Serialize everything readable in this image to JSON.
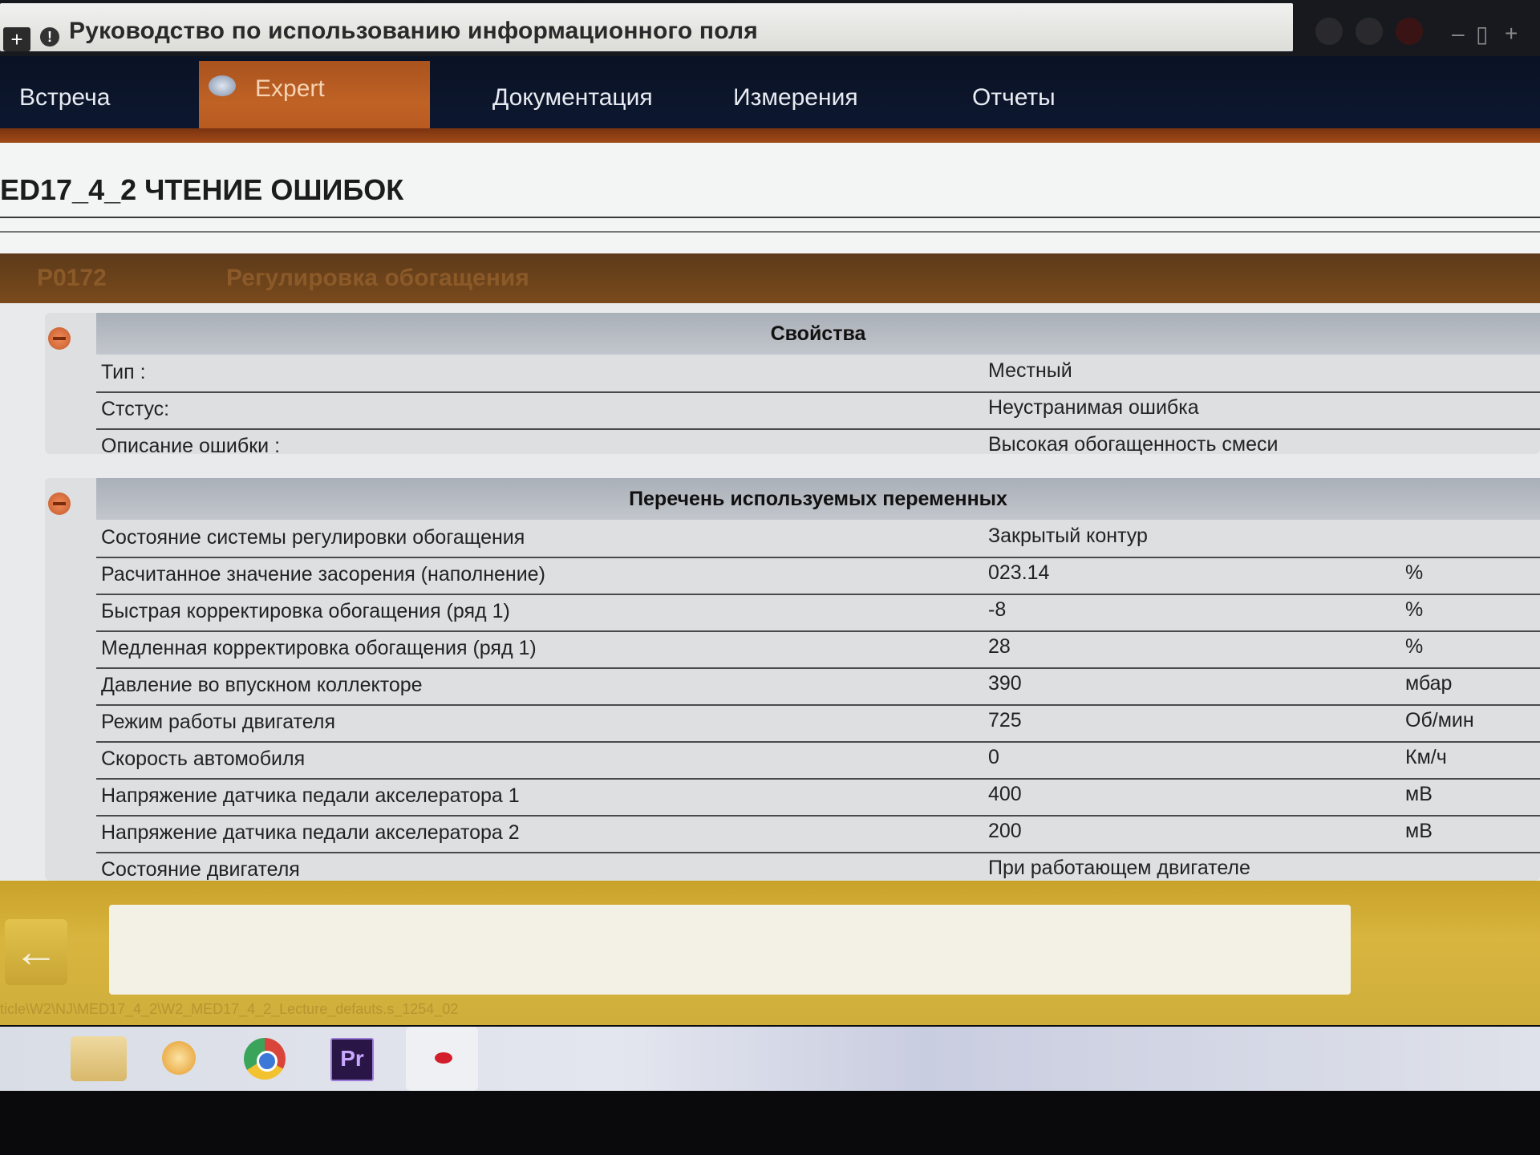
{
  "window": {
    "title": "Руководство по использованию информационного поля"
  },
  "tabs": [
    {
      "label": "Встреча"
    },
    {
      "label": "Expert",
      "active": true
    },
    {
      "label": "Документация"
    },
    {
      "label": "Измерения"
    },
    {
      "label": "Отчеты"
    }
  ],
  "page": {
    "heading": "ED17_4_2  ЧТЕНИЕ ОШИБОК"
  },
  "dtc": {
    "code": "P0172",
    "description": "Регулировка обогащения"
  },
  "properties": {
    "header": "Свойства",
    "rows": [
      {
        "key": "Тип :",
        "value": "Местный"
      },
      {
        "key": "Стстус:",
        "value": "Неустранимая ошибка"
      },
      {
        "key": "Описание ошибки :",
        "value": "Высокая обогащенность смеси"
      }
    ]
  },
  "variables": {
    "header": "Перечень используемых переменных",
    "rows": [
      {
        "key": "Состояние системы регулировки обогащения",
        "value": "Закрытый контур",
        "unit": ""
      },
      {
        "key": "Расчитанное значение засорения (наполнение)",
        "value": "023.14",
        "unit": "%"
      },
      {
        "key": "Быстрая корректировка обогащения (ряд 1)",
        "value": "-8",
        "unit": "%"
      },
      {
        "key": "Медленная корректировка обогащения (ряд 1)",
        "value": "28",
        "unit": "%"
      },
      {
        "key": "Давление во впускном коллекторе",
        "value": "390",
        "unit": "мбар"
      },
      {
        "key": "Режим работы двигателя",
        "value": "725",
        "unit": "Об/мин"
      },
      {
        "key": "Скорость автомобиля",
        "value": "0",
        "unit": "Км/ч"
      },
      {
        "key": "Напряжение датчика педали акселератора 1",
        "value": "400",
        "unit": "мВ"
      },
      {
        "key": "Напряжение датчика педали акселератора 2",
        "value": "200",
        "unit": "мВ"
      },
      {
        "key": "Состояние двигателя",
        "value": "При работающем двигателе",
        "unit": ""
      }
    ]
  },
  "footer": {
    "back_icon": "arrow-left-icon",
    "path": "ticle\\W2\\NJ\\MED17_4_2\\W2_MED17_4_2_Lecture_defauts.s_1254_02"
  },
  "taskbar": {
    "pr_label": "Pr"
  },
  "colors": {
    "tab_active": "#c06225",
    "dtc_bar": "#6e4420",
    "footer_bar": "#d2ad38",
    "tab_bar": "#0c1529"
  }
}
